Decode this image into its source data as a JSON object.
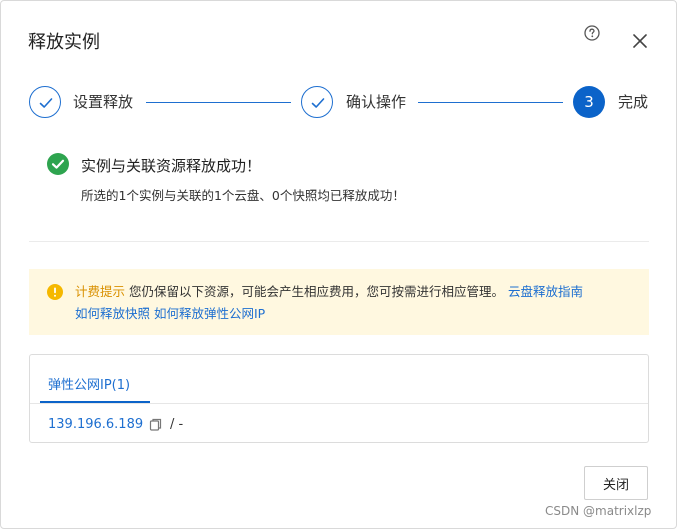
{
  "dialog": {
    "title": "释放实例",
    "help_icon": "question-circle-icon",
    "close_icon": "close-icon"
  },
  "steps": [
    {
      "label": "设置释放",
      "state": "done",
      "icon": "check-icon"
    },
    {
      "label": "确认操作",
      "state": "done",
      "icon": "check-icon"
    },
    {
      "label": "完成",
      "state": "active",
      "number": "3"
    }
  ],
  "result": {
    "icon": "success-check-icon",
    "title": "实例与关联资源释放成功！",
    "description": "所选的1个实例与关联的1个云盘、0个快照均已释放成功！"
  },
  "notice": {
    "icon": "warning-icon",
    "prefix": "计费提示",
    "text": "您仍保留以下资源，可能会产生相应费用，您可按需进行相应管理。",
    "links": [
      "云盘释放指南",
      "如何释放快照",
      "如何释放弹性公网IP"
    ]
  },
  "resources": {
    "tab_label": "弹性公网IP(1)",
    "ip": "139.196.6.189",
    "copy_icon": "copy-icon",
    "extra": "/ -"
  },
  "footer": {
    "close_label": "关闭"
  },
  "watermark": "CSDN @matrixlzp",
  "colors": {
    "primary": "#1e6fd0",
    "success": "#2ea44f",
    "warning": "#f5b800",
    "notice_bg": "#fff8e0"
  }
}
